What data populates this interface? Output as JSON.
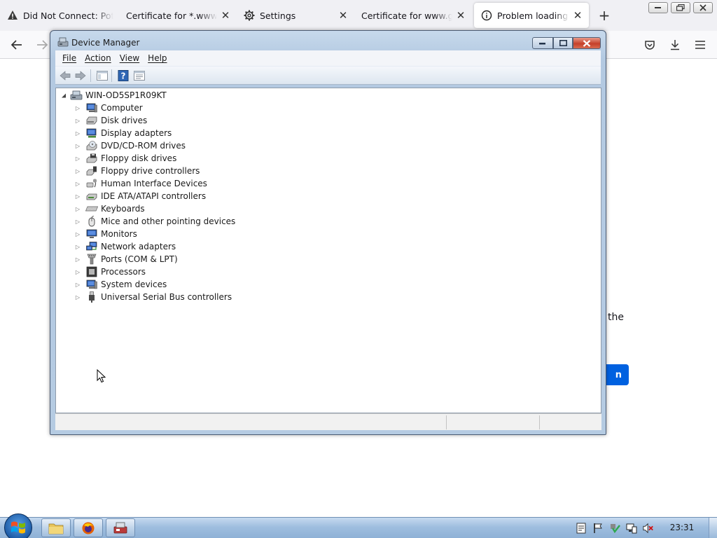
{
  "browser": {
    "tabs": [
      {
        "title": "Did Not Connect: Potential Security Issue",
        "icon": "warning-icon",
        "selected": false
      },
      {
        "title": "Certificate for *.www.mozilla.org",
        "icon": "",
        "selected": false
      },
      {
        "title": "Settings",
        "icon": "gear-icon",
        "selected": false
      },
      {
        "title": "Certificate for www.google.com",
        "icon": "",
        "selected": false
      },
      {
        "title": "Problem loading page",
        "icon": "info-icon",
        "selected": true
      }
    ],
    "new_tab_label": "+",
    "page": {
      "partial_text": "the",
      "partial_button": "n"
    },
    "accent_color": "#0061e0"
  },
  "device_manager": {
    "title": "Device Manager",
    "menu": [
      "File",
      "Action",
      "View",
      "Help"
    ],
    "root": "WIN-OD5SP1R09KT",
    "categories": [
      {
        "label": "Computer",
        "icon": "computer-icon"
      },
      {
        "label": "Disk drives",
        "icon": "disk-drive-icon"
      },
      {
        "label": "Display adapters",
        "icon": "display-adapter-icon"
      },
      {
        "label": "DVD/CD-ROM drives",
        "icon": "dvd-drive-icon"
      },
      {
        "label": "Floppy disk drives",
        "icon": "floppy-drive-icon"
      },
      {
        "label": "Floppy drive controllers",
        "icon": "floppy-controller-icon"
      },
      {
        "label": "Human Interface Devices",
        "icon": "hid-icon"
      },
      {
        "label": "IDE ATA/ATAPI controllers",
        "icon": "ide-controller-icon"
      },
      {
        "label": "Keyboards",
        "icon": "keyboard-icon"
      },
      {
        "label": "Mice and other pointing devices",
        "icon": "mouse-icon"
      },
      {
        "label": "Monitors",
        "icon": "monitor-icon"
      },
      {
        "label": "Network adapters",
        "icon": "network-adapter-icon"
      },
      {
        "label": "Ports (COM & LPT)",
        "icon": "ports-icon"
      },
      {
        "label": "Processors",
        "icon": "processor-icon"
      },
      {
        "label": "System devices",
        "icon": "system-devices-icon"
      },
      {
        "label": "Universal Serial Bus controllers",
        "icon": "usb-icon"
      }
    ]
  },
  "taskbar": {
    "clock": "23:31",
    "pinned": [
      "explorer-icon",
      "firefox-icon",
      "device-manager-icon"
    ],
    "tray": [
      "action-center-icon",
      "flag-icon",
      "security-icon",
      "network-icon",
      "volume-muted-icon"
    ]
  }
}
